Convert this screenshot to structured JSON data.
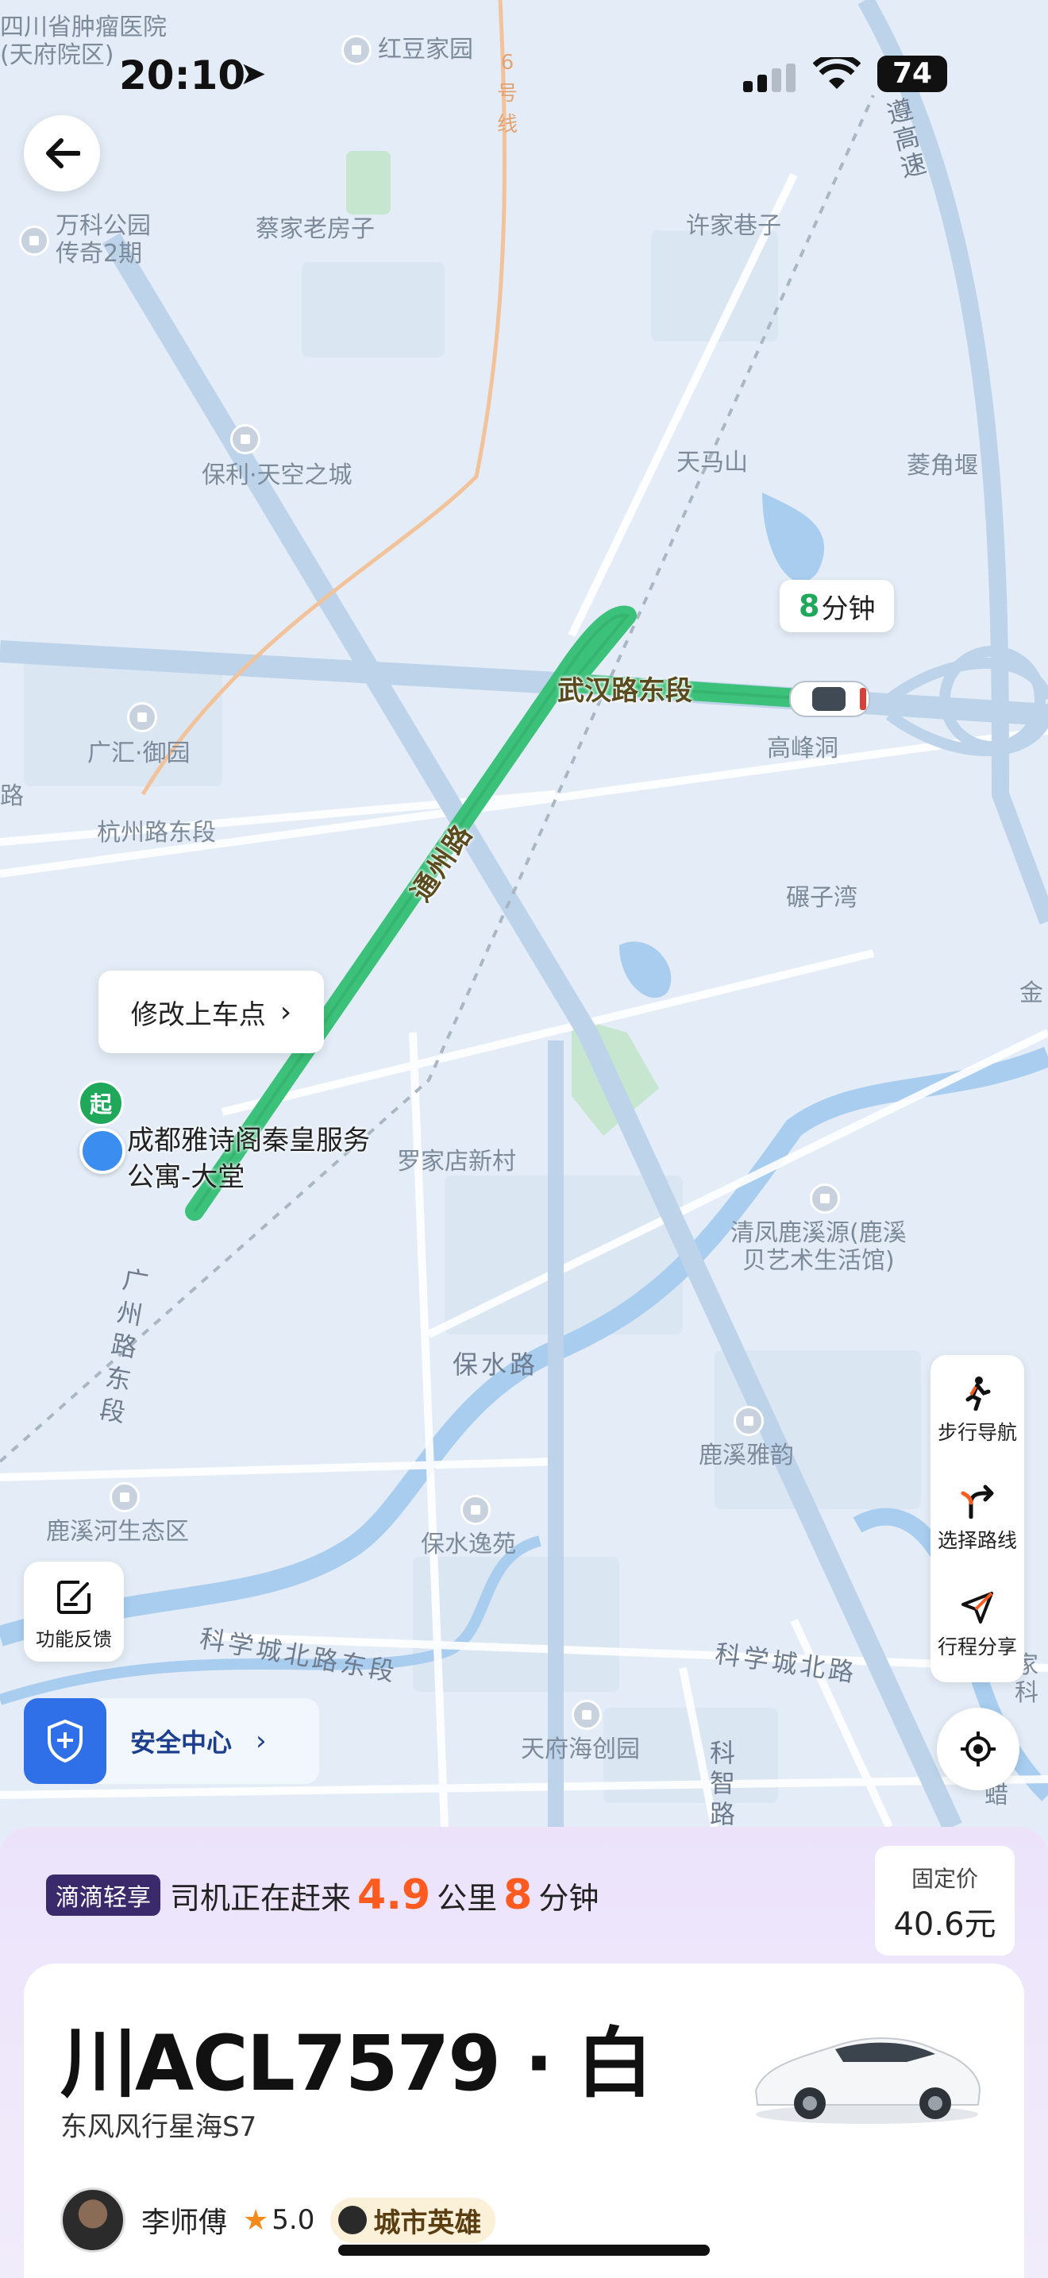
{
  "status_bar": {
    "time": "20:10",
    "battery": "74"
  },
  "map": {
    "labels": {
      "hospital": "四川省肿瘤医院\n(天府院区)",
      "hongdou": "红豆家园",
      "line6": "6\n号\n线",
      "wanke": "万科公园\n传奇2期",
      "caijia": "蔡家老房子",
      "xujia": "许家巷子",
      "baoli": "保利·天空之城",
      "tianmashan": "天马山",
      "lingjiao": "菱角堰",
      "guanghui": "广汇·御园",
      "hangzhou": "杭州路东段",
      "gaofengdong": "高峰洞",
      "nianziwan": "碾子湾",
      "luojiadian": "罗家店新村",
      "qingfeng": "清凤鹿溪源(鹿溪\n贝艺术生活馆)",
      "guangzhou": "广\n州\n路\n东\n段",
      "baoshui_road": "保水路",
      "luxi_yayun": "鹿溪雅韵",
      "luxi_park": "鹿溪河生态区",
      "baoshui_yiyuan": "保水逸苑",
      "kexuecheng_east": "科学城北路东段",
      "kexuecheng": "科学城北路",
      "tianfu_haichuang": "天府海创园",
      "kezhi": "科\n智\n路",
      "expressway": "遵\n高\n速",
      "jin": "金",
      "jia": "家\n科",
      "la": "蜡",
      "lu_left": "路"
    },
    "route_roads": {
      "wuhan": "武汉路东段",
      "tongzhou": "通州路"
    },
    "eta_bubble": {
      "minutes": "8",
      "unit": "分钟"
    },
    "change_pickup": "修改上车点",
    "start_badge": "起",
    "pickup_name": "成都雅诗阁秦皇服务公寓-大堂",
    "route_color": "#3cc17a"
  },
  "side_panel": {
    "walk_nav": "步行导航",
    "choose_route": "选择路线",
    "share_trip": "行程分享"
  },
  "feedback": "功能反馈",
  "safety_center": "安全中心",
  "sheet": {
    "brand": "滴滴轻享",
    "driver_coming": "司机正在赶来",
    "distance_value": "4.9",
    "distance_unit": "公里",
    "time_value": "8",
    "time_unit": "分钟",
    "price_title": "固定价",
    "price_value": "40.6元"
  },
  "card": {
    "plate": "川ACL7579 · 白",
    "model": "东风风行星海S7",
    "driver_name": "李师傅",
    "rating": "5.0",
    "badge": "城市英雄"
  }
}
